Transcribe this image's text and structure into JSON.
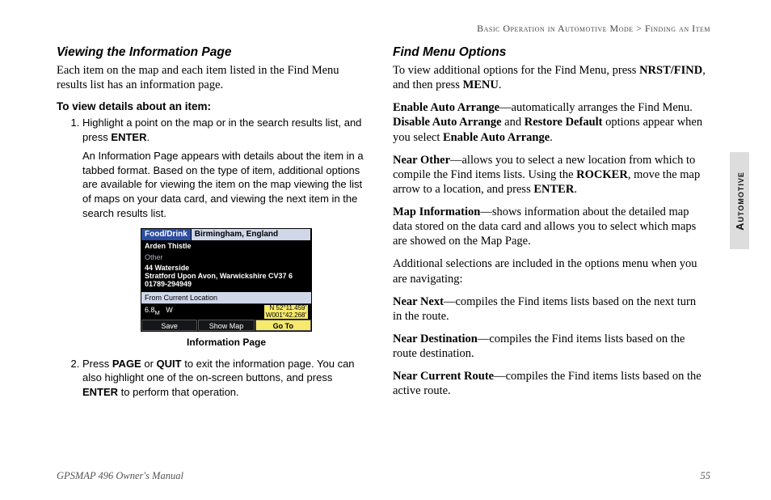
{
  "header": {
    "breadcrumb_left": "Basic Operation in Automotive Mode",
    "breadcrumb_sep": " > ",
    "breadcrumb_right": "Finding an Item"
  },
  "side_tab": "Automotive",
  "left": {
    "heading": "Viewing the Information Page",
    "intro": "Each item on the map and each item listed in the Find Menu results list has an information page.",
    "howto_title": "To view details about an item:",
    "step1_a": "Highlight a point on the map or in the search results list, and press ",
    "step1_key": "ENTER",
    "step1_b": ".",
    "step1_para": "An Information Page appears with details about the item in a tabbed format. Based on the type of item, additional options are available for viewing the item on the map viewing the list of maps on your data card, and viewing the next item in the search results list.",
    "caption": "Information Page",
    "step2_a": "Press ",
    "step2_k1": "PAGE",
    "step2_b": " or ",
    "step2_k2": "QUIT",
    "step2_c": " to exit the information page. You can also highlight one of the on-screen buttons, and press ",
    "step2_k3": "ENTER",
    "step2_d": " to perform that operation."
  },
  "device": {
    "tab1": "Food/Drink",
    "tab2": "Birmingham, England",
    "name": "Arden Thistle",
    "other_label": "Other",
    "addr1": "44 Waterside",
    "addr2": "Stratford Upon Avon, Warwickshire CV37 6",
    "phone": "01789-294949",
    "from_label": "From Current Location",
    "dist": "6.8",
    "dist_unit": "M",
    "bearing": "W",
    "coord1": "N  52°11.459'",
    "coord2": "W001°42.268'",
    "btn1": "Save",
    "btn2": "Show Map",
    "btn3": "Go To"
  },
  "right": {
    "heading": "Find Menu Options",
    "p1_a": "To view additional options for the Find Menu, press ",
    "p1_k1": "NRST/FIND",
    "p1_b": ", and then press ",
    "p1_k2": "MENU",
    "p1_c": ".",
    "p2_k1": "Enable Auto Arrange",
    "p2_a": "—automatically arranges the Find Menu. ",
    "p2_k2": "Disable Auto Arrange",
    "p2_b": " and ",
    "p2_k3": "Restore Default",
    "p2_c": " options appear when you select ",
    "p2_k4": "Enable Auto Arrange",
    "p2_d": ".",
    "p3_k": "Near Other",
    "p3_a": "—allows you to select a new location from which to compile the Find items lists. Using the ",
    "p3_k2": "ROCKER",
    "p3_b": ", move the map arrow to a location, and press ",
    "p3_k3": "ENTER",
    "p3_c": ".",
    "p4_k": "Map Information",
    "p4_a": "—shows information about the detailed map data stored on the data card and allows you to select which maps are showed on the Map Page.",
    "p5": "Additional selections are included in the options menu when you are navigating:",
    "p6_k": "Near Next",
    "p6_a": "—compiles the Find items lists based on the next turn in the route.",
    "p7_k": "Near Destination",
    "p7_a": "—compiles the Find items lists based on the route destination.",
    "p8_k": "Near Current Route",
    "p8_a": "—compiles the Find items lists based on the active route."
  },
  "footer": {
    "left": "GPSMAP 496 Owner's Manual",
    "right": "55"
  }
}
